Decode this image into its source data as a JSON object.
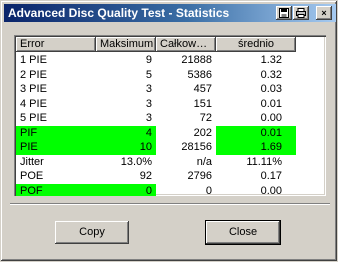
{
  "window": {
    "title": "Advanced Disc Quality Test - Statistics",
    "buttons": {
      "save_icon": "save-icon",
      "print_icon": "print-icon",
      "close_glyph": "×"
    }
  },
  "table": {
    "columns": [
      "Error",
      "Maksimum",
      "Całkow…",
      "średnio"
    ],
    "rows": [
      {
        "error": "1 PIE",
        "max": "9",
        "total": "21888",
        "avg": "1.32",
        "highlight": false
      },
      {
        "error": "2 PIE",
        "max": "5",
        "total": "5386",
        "avg": "0.32",
        "highlight": false
      },
      {
        "error": "3 PIE",
        "max": "3",
        "total": "457",
        "avg": "0.03",
        "highlight": false
      },
      {
        "error": "4 PIE",
        "max": "3",
        "total": "151",
        "avg": "0.01",
        "highlight": false
      },
      {
        "error": "5 PIE",
        "max": "3",
        "total": "72",
        "avg": "0.00",
        "highlight": false
      },
      {
        "error": "PIF",
        "max": "4",
        "total": "202",
        "avg": "0.01",
        "highlight": true
      },
      {
        "error": "PIE",
        "max": "10",
        "total": "28156",
        "avg": "1.69",
        "highlight": true
      },
      {
        "error": "Jitter",
        "max": "13.0%",
        "total": "n/a",
        "avg": "11.11%",
        "highlight": false
      },
      {
        "error": "POE",
        "max": "92",
        "total": "2796",
        "avg": "0.17",
        "highlight": false
      },
      {
        "error": "POF",
        "max": "0",
        "total": "0",
        "avg": "0.00",
        "highlight": "partial"
      }
    ]
  },
  "footer": {
    "copy_label": "Copy",
    "close_label": "Close"
  },
  "colors": {
    "highlight": "#00ff00",
    "title_start": "#0a246a",
    "title_end": "#a6caf0"
  }
}
